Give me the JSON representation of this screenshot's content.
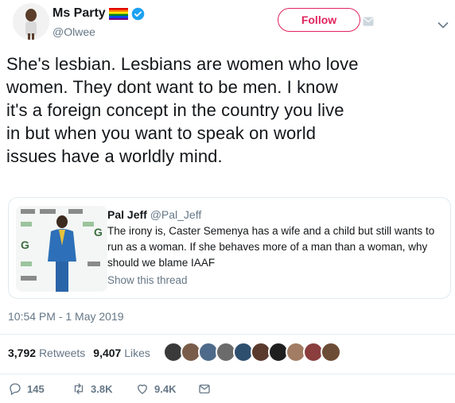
{
  "header": {
    "display_name": "Ms Party",
    "handle": "@Olwee",
    "follow_label": "Follow"
  },
  "tweet": {
    "text": "She's lesbian. Lesbians are women who love\nwomen. They dont want to be men. I know\nit's a foreign concept in the country you live\nin but when you want to speak on world\nissues have a worldly mind."
  },
  "quoted": {
    "name": "Pal Jeff",
    "handle": "@Pal_Jeff",
    "text": "The irony is, Caster Semenya has a wife and a child but still wants to run as a woman. If she behaves more of a man than a woman, why should we blame IAAF",
    "show_thread": "Show this thread"
  },
  "timestamp": "10:54 PM - 1 May 2019",
  "stats": {
    "retweets_count": "3,792",
    "retweets_label": "Retweets",
    "likes_count": "9,407",
    "likes_label": "Likes"
  },
  "actions": {
    "reply_count": "145",
    "retweet_count": "3.8K",
    "like_count": "9.4K"
  },
  "colors": {
    "follow_accent": "#e0245e",
    "verified": "#1da1f2",
    "secondary_text": "#657786"
  },
  "icons": [
    "rainbow-flag-icon",
    "verified-badge-icon",
    "direct-message-icon",
    "chevron-down-icon",
    "reply-icon",
    "retweet-icon",
    "like-icon",
    "share-icon"
  ]
}
